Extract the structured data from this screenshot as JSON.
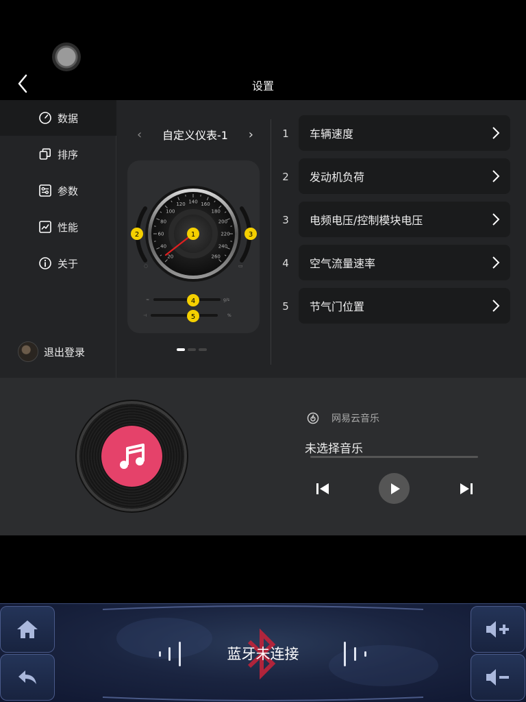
{
  "header": {
    "title": "设置"
  },
  "sidebar": {
    "items": [
      {
        "label": "数据",
        "icon": "speedometer-icon",
        "active": true
      },
      {
        "label": "排序",
        "icon": "stack-icon",
        "active": false
      },
      {
        "label": "参数",
        "icon": "sliders-icon",
        "active": false
      },
      {
        "label": "性能",
        "icon": "line-chart-icon",
        "active": false
      },
      {
        "label": "关于",
        "icon": "info-icon",
        "active": false
      }
    ],
    "logout_label": "退出登录"
  },
  "gauge": {
    "name": "自定义仪表-1",
    "scale_labels": [
      "20",
      "40",
      "60",
      "80",
      "100",
      "120",
      "140",
      "160",
      "180",
      "200",
      "220",
      "240",
      "260"
    ],
    "markers": [
      "1",
      "2",
      "3",
      "4",
      "5"
    ],
    "bar_units": [
      "g/s",
      "%"
    ],
    "page_count": 3,
    "active_page": 1
  },
  "data_rows": [
    {
      "num": "1",
      "label": "车辆速度"
    },
    {
      "num": "2",
      "label": "发动机负荷"
    },
    {
      "num": "3",
      "label": "电频电压/控制模块电压"
    },
    {
      "num": "4",
      "label": "空气流量速率"
    },
    {
      "num": "5",
      "label": "节气门位置"
    }
  ],
  "music": {
    "source": "网易云音乐",
    "song": "未选择音乐"
  },
  "dock": {
    "bluetooth_status": "蓝牙未连接"
  },
  "colors": {
    "accent": "#e5426a",
    "marker": "#f5d000",
    "panel": "#232426",
    "row": "#1a1b1c"
  }
}
